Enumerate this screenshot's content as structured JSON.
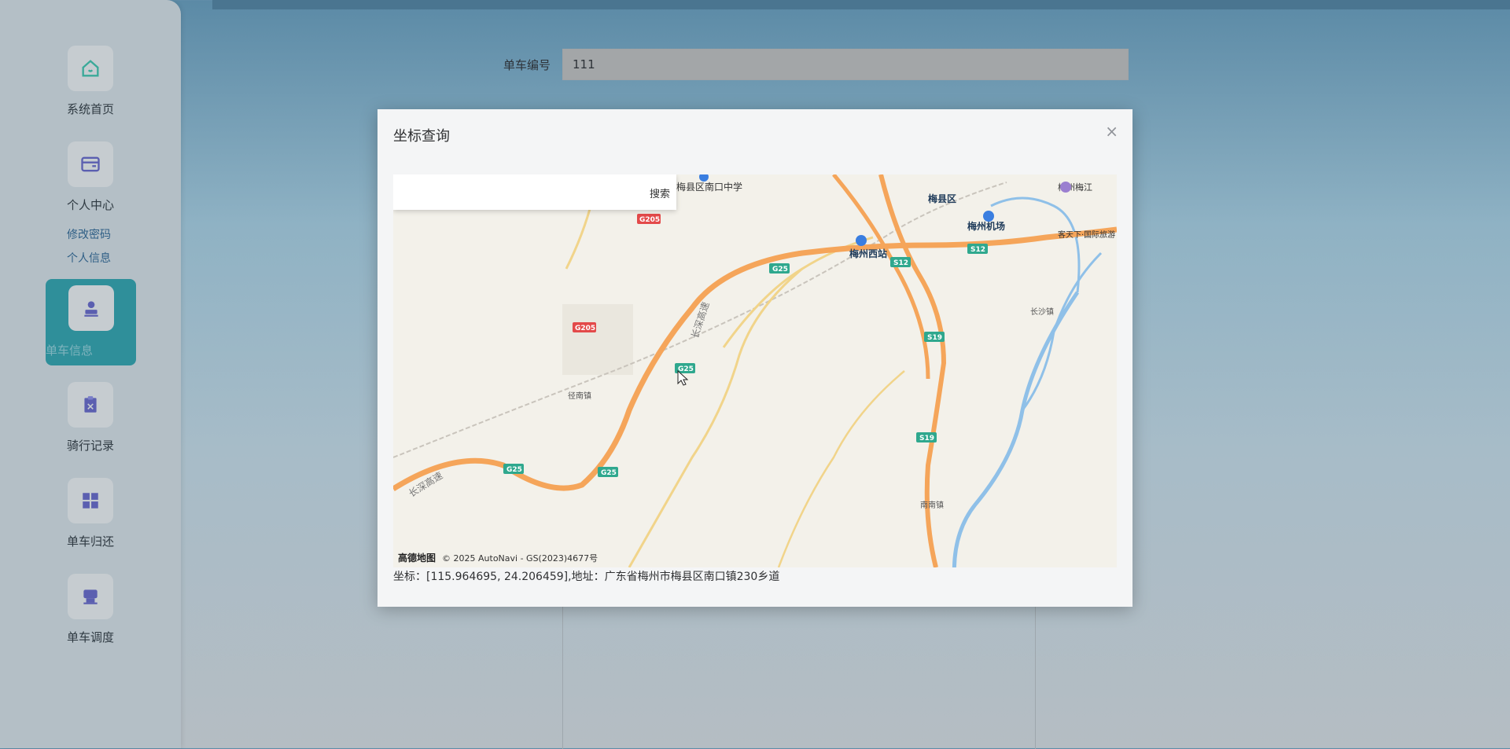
{
  "sidebar": {
    "items": [
      {
        "label": "系统首页",
        "icon": "home-icon"
      },
      {
        "label": "个人中心",
        "icon": "wallet-icon"
      },
      {
        "label": "单车信息",
        "icon": "stamp-icon"
      },
      {
        "label": "骑行记录",
        "icon": "clipboard-icon"
      },
      {
        "label": "单车归还",
        "icon": "grid-icon"
      },
      {
        "label": "单车调度",
        "icon": "printer-icon"
      }
    ],
    "submenu": [
      "修改密码",
      "个人信息"
    ]
  },
  "form": {
    "bike_no_label": "单车编号",
    "bike_no_value": "111"
  },
  "dialog": {
    "title": "坐标查询",
    "close": "×",
    "search_button": "搜索",
    "coordinate_text": "坐标：[115.964695, 24.206459],地址：广东省梅州市梅县区南口镇230乡道"
  },
  "map": {
    "attribution": "© 2025 AutoNavi - GS(2023)4677号",
    "logo": "高德地图",
    "labels": {
      "meixian": "梅县区",
      "meizhou_west": "梅州西站",
      "meizhou_airport": "梅州机场",
      "nankou_school": "梅县区南口中学",
      "meizhou_meijiang": "梅州梅江",
      "kejiaxiang": "客天下·国际旅游",
      "changsha": "长沙镇",
      "nannan": "南南镇",
      "jingnan": "径南镇",
      "zhangkeng": "长深高速"
    },
    "shields": [
      "G205",
      "G25",
      "S12",
      "S19"
    ],
    "colors": {
      "highway": "#f5a55a",
      "water": "#8fc0e8",
      "road": "#f1d48a"
    }
  }
}
